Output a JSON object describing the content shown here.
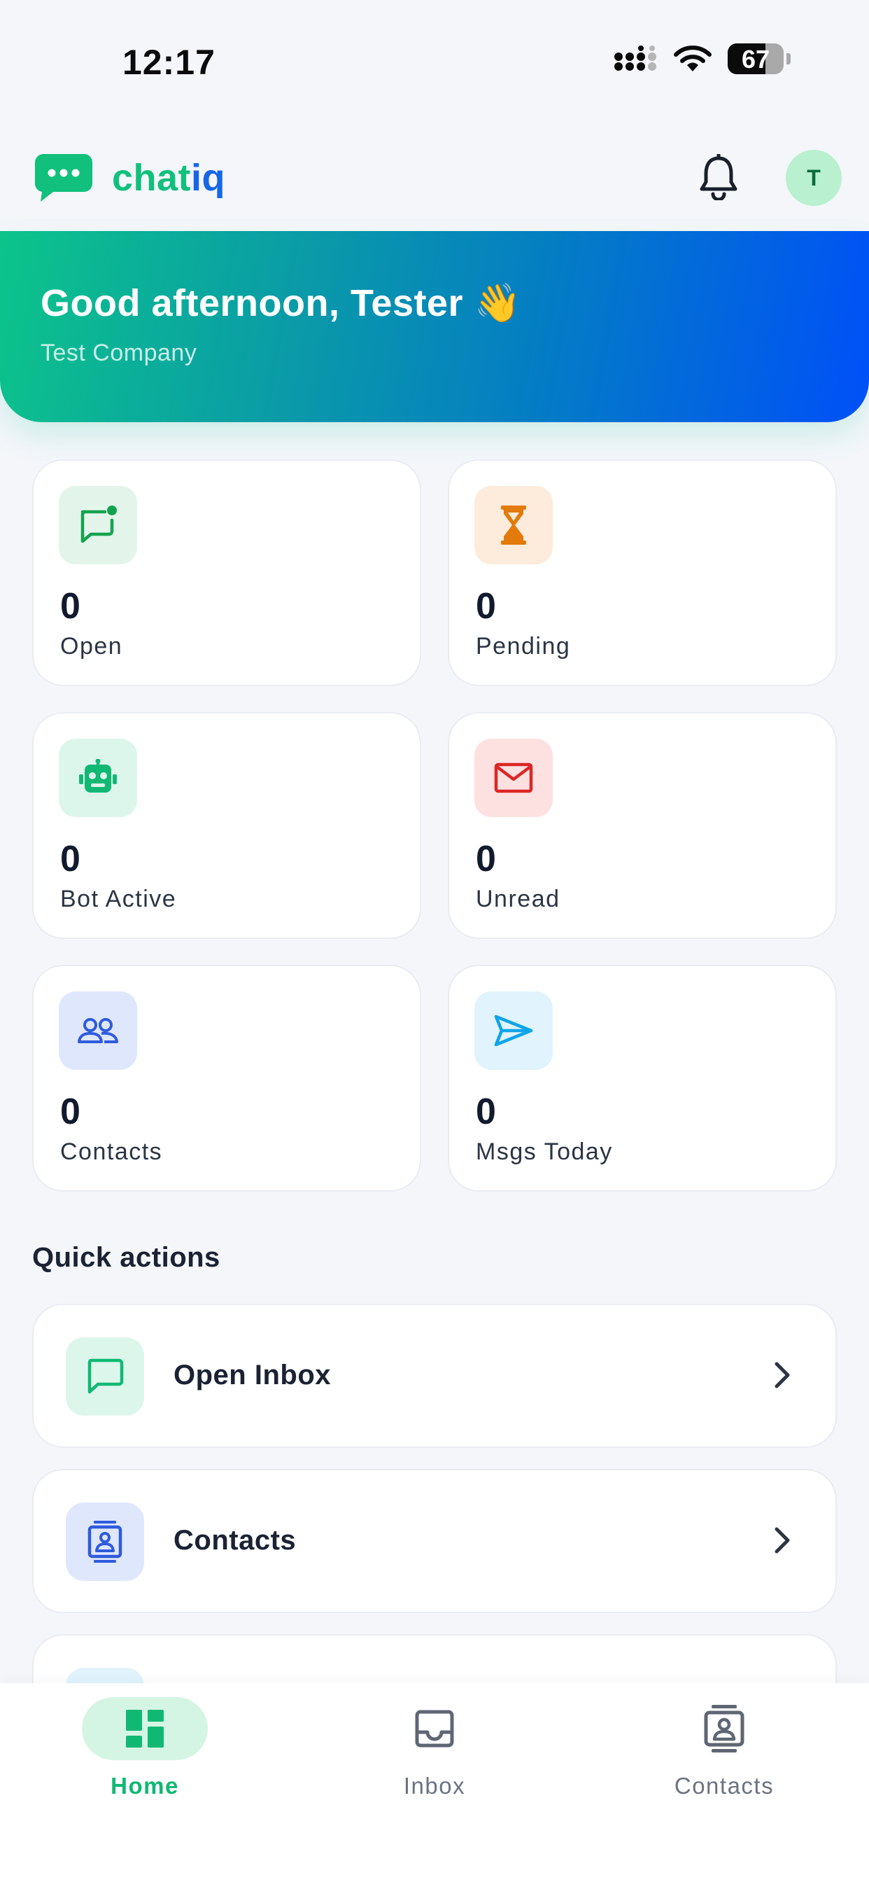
{
  "status_bar": {
    "time": "12:17",
    "battery": "67",
    "battery_level": 0.67
  },
  "header": {
    "brand_prefix": "chat",
    "brand_accent": "iq",
    "avatar_initial": "T",
    "brand_color": "#10c07c",
    "accent_color": "#1667e6"
  },
  "banner": {
    "greeting": "Good afternoon, Tester 👋",
    "company": "Test Company"
  },
  "stats": [
    {
      "value": "0",
      "label": "Open",
      "icon": "chat-dot-icon",
      "icon_bg": "#e3f5ea",
      "icon_color": "#13a24f"
    },
    {
      "value": "0",
      "label": "Pending",
      "icon": "hourglass-icon",
      "icon_bg": "#fdecdb",
      "icon_color": "#e37a0b"
    },
    {
      "value": "0",
      "label": "Bot Active",
      "icon": "robot-icon",
      "icon_bg": "#dcf6ec",
      "icon_color": "#10b874"
    },
    {
      "value": "0",
      "label": "Unread",
      "icon": "envelope-icon",
      "icon_bg": "#fde1e1",
      "icon_color": "#dc2626"
    },
    {
      "value": "0",
      "label": "Contacts",
      "icon": "users-icon",
      "icon_bg": "#dfe7fd",
      "icon_color": "#2f5bdc"
    },
    {
      "value": "0",
      "label": "Msgs Today",
      "icon": "send-icon",
      "icon_bg": "#e1f3fd",
      "icon_color": "#0ea5e9"
    }
  ],
  "quick_actions": {
    "title": "Quick actions",
    "items": [
      {
        "label": "Open Inbox",
        "icon": "chat-icon",
        "icon_bg": "#dcf6ec",
        "icon_color": "#10b874"
      },
      {
        "label": "Contacts",
        "icon": "contact-card-icon",
        "icon_bg": "#dfe7fd",
        "icon_color": "#2f5bdc"
      },
      {
        "label": "",
        "icon": "unknown-icon",
        "icon_bg": "#e1f3fd",
        "icon_color": "#0ea5e9"
      }
    ]
  },
  "bottom_nav": {
    "items": [
      {
        "label": "Home",
        "icon": "dashboard-icon",
        "active": true
      },
      {
        "label": "Inbox",
        "icon": "inbox-tray-icon",
        "active": false
      },
      {
        "label": "Contacts",
        "icon": "contact-card-icon",
        "active": false
      }
    ]
  }
}
